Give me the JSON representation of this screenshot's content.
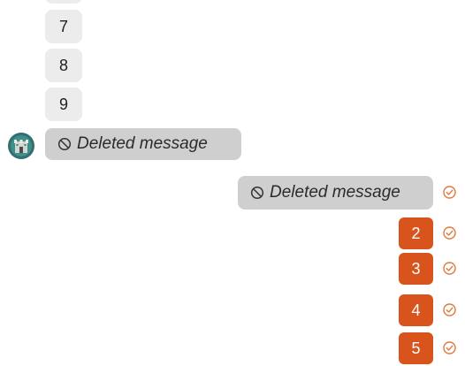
{
  "incoming": {
    "numbers": [
      "",
      "7",
      "8",
      "9"
    ],
    "deleted_text": "Deleted message"
  },
  "outgoing": {
    "deleted_text": "Deleted message",
    "numbers": [
      "2",
      "3",
      "4",
      "5"
    ]
  },
  "colors": {
    "incoming_bubble": "#ececec",
    "deleted_bubble": "#cfcfcf",
    "outgoing_bubble": "#d9541c",
    "check": "#e07a3e"
  },
  "icons": {
    "deleted": "ban-icon",
    "status": "check-circle-icon",
    "avatar": "castle-avatar-icon"
  }
}
